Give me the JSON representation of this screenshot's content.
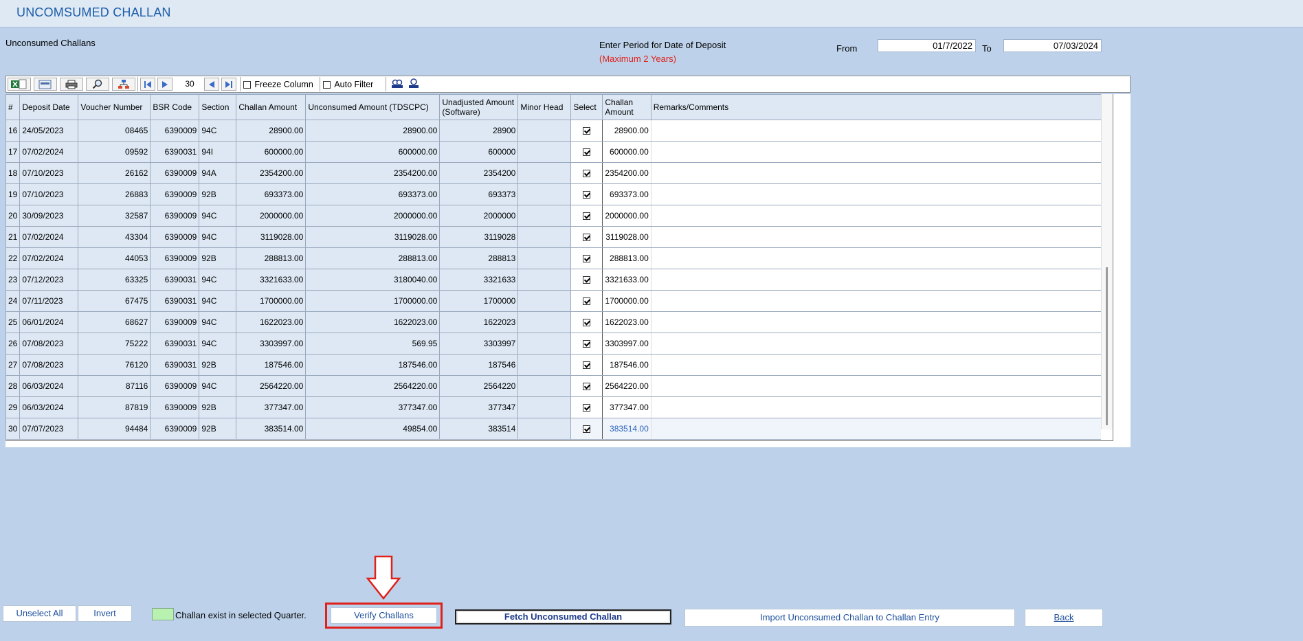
{
  "window": {
    "title": "UNCOMSUMED CHALLAN"
  },
  "header": {
    "section_label": "Unconsumed Challans",
    "period_label": "Enter Period for Date of Deposit",
    "period_note": "(Maximum 2 Years)",
    "from_label": "From",
    "from_value": "01/7/2022",
    "to_label": "To",
    "to_value": "07/03/2024"
  },
  "toolbar": {
    "page_size": "30",
    "freeze_column_label": "Freeze Column",
    "auto_filter_label": "Auto Filter",
    "icons": [
      "excel-icon",
      "export-icon",
      "print-icon",
      "search-icon",
      "tree-icon",
      "first-page-icon",
      "prev-page-icon",
      "back-icon",
      "last-page-icon",
      "find-icon",
      "find-next-icon"
    ]
  },
  "grid": {
    "columns": [
      "#",
      "Deposit Date",
      "Voucher Number",
      "BSR Code",
      "Section",
      "Challan Amount",
      "Unconsumed Amount (TDSCPC)",
      "Unadjusted Amount (Software)",
      "Minor Head",
      "Select",
      "Challan Amount",
      "Remarks/Comments"
    ],
    "rows": [
      {
        "no": "16",
        "date": "24/05/2023",
        "voucher": "08465",
        "bsr": "6390009",
        "section": "94C",
        "amount": "28900.00",
        "unconsumed": "28900.00",
        "unadjusted": "28900",
        "minor": "",
        "selected": true,
        "challan_amount": "28900.00",
        "remarks": ""
      },
      {
        "no": "17",
        "date": "07/02/2024",
        "voucher": "09592",
        "bsr": "6390031",
        "section": "94I",
        "amount": "600000.00",
        "unconsumed": "600000.00",
        "unadjusted": "600000",
        "minor": "",
        "selected": true,
        "challan_amount": "600000.00",
        "remarks": ""
      },
      {
        "no": "18",
        "date": "07/10/2023",
        "voucher": "26162",
        "bsr": "6390009",
        "section": "94A",
        "amount": "2354200.00",
        "unconsumed": "2354200.00",
        "unadjusted": "2354200",
        "minor": "",
        "selected": true,
        "challan_amount": "2354200.00",
        "remarks": ""
      },
      {
        "no": "19",
        "date": "07/10/2023",
        "voucher": "26883",
        "bsr": "6390009",
        "section": "92B",
        "amount": "693373.00",
        "unconsumed": "693373.00",
        "unadjusted": "693373",
        "minor": "",
        "selected": true,
        "challan_amount": "693373.00",
        "remarks": ""
      },
      {
        "no": "20",
        "date": "30/09/2023",
        "voucher": "32587",
        "bsr": "6390009",
        "section": "94C",
        "amount": "2000000.00",
        "unconsumed": "2000000.00",
        "unadjusted": "2000000",
        "minor": "",
        "selected": true,
        "challan_amount": "2000000.00",
        "remarks": ""
      },
      {
        "no": "21",
        "date": "07/02/2024",
        "voucher": "43304",
        "bsr": "6390009",
        "section": "94C",
        "amount": "3119028.00",
        "unconsumed": "3119028.00",
        "unadjusted": "3119028",
        "minor": "",
        "selected": true,
        "challan_amount": "3119028.00",
        "remarks": ""
      },
      {
        "no": "22",
        "date": "07/02/2024",
        "voucher": "44053",
        "bsr": "6390009",
        "section": "92B",
        "amount": "288813.00",
        "unconsumed": "288813.00",
        "unadjusted": "288813",
        "minor": "",
        "selected": true,
        "challan_amount": "288813.00",
        "remarks": ""
      },
      {
        "no": "23",
        "date": "07/12/2023",
        "voucher": "63325",
        "bsr": "6390031",
        "section": "94C",
        "amount": "3321633.00",
        "unconsumed": "3180040.00",
        "unadjusted": "3321633",
        "minor": "",
        "selected": true,
        "challan_amount": "3321633.00",
        "remarks": ""
      },
      {
        "no": "24",
        "date": "07/11/2023",
        "voucher": "67475",
        "bsr": "6390031",
        "section": "94C",
        "amount": "1700000.00",
        "unconsumed": "1700000.00",
        "unadjusted": "1700000",
        "minor": "",
        "selected": true,
        "challan_amount": "1700000.00",
        "remarks": ""
      },
      {
        "no": "25",
        "date": "06/01/2024",
        "voucher": "68627",
        "bsr": "6390009",
        "section": "94C",
        "amount": "1622023.00",
        "unconsumed": "1622023.00",
        "unadjusted": "1622023",
        "minor": "",
        "selected": true,
        "challan_amount": "1622023.00",
        "remarks": ""
      },
      {
        "no": "26",
        "date": "07/08/2023",
        "voucher": "75222",
        "bsr": "6390031",
        "section": "94C",
        "amount": "3303997.00",
        "unconsumed": "569.95",
        "unadjusted": "3303997",
        "minor": "",
        "selected": true,
        "challan_amount": "3303997.00",
        "remarks": ""
      },
      {
        "no": "27",
        "date": "07/08/2023",
        "voucher": "76120",
        "bsr": "6390031",
        "section": "92B",
        "amount": "187546.00",
        "unconsumed": "187546.00",
        "unadjusted": "187546",
        "minor": "",
        "selected": true,
        "challan_amount": "187546.00",
        "remarks": ""
      },
      {
        "no": "28",
        "date": "06/03/2024",
        "voucher": "87116",
        "bsr": "6390009",
        "section": "94C",
        "amount": "2564220.00",
        "unconsumed": "2564220.00",
        "unadjusted": "2564220",
        "minor": "",
        "selected": true,
        "challan_amount": "2564220.00",
        "remarks": ""
      },
      {
        "no": "29",
        "date": "06/03/2024",
        "voucher": "87819",
        "bsr": "6390009",
        "section": "92B",
        "amount": "377347.00",
        "unconsumed": "377347.00",
        "unadjusted": "377347",
        "minor": "",
        "selected": true,
        "challan_amount": "377347.00",
        "remarks": ""
      },
      {
        "no": "30",
        "date": "07/07/2023",
        "voucher": "94484",
        "bsr": "6390009",
        "section": "92B",
        "amount": "383514.00",
        "unconsumed": "49854.00",
        "unadjusted": "383514",
        "minor": "",
        "selected": true,
        "challan_amount": "383514.00",
        "remarks": ""
      }
    ]
  },
  "footer": {
    "unselect_all": "Unselect All",
    "invert": "Invert",
    "legend_text": "Challan exist in selected Quarter.",
    "verify": "Verify Challans",
    "fetch": "Fetch Unconsumed Challan",
    "import": "Import Unconsumed Challan to Challan Entry",
    "back": "Back"
  },
  "colors": {
    "background": "#bdd2ea",
    "title": "#1b5ca8",
    "highlight_box": "#e0201a",
    "legend_green": "#b9f2b0"
  }
}
